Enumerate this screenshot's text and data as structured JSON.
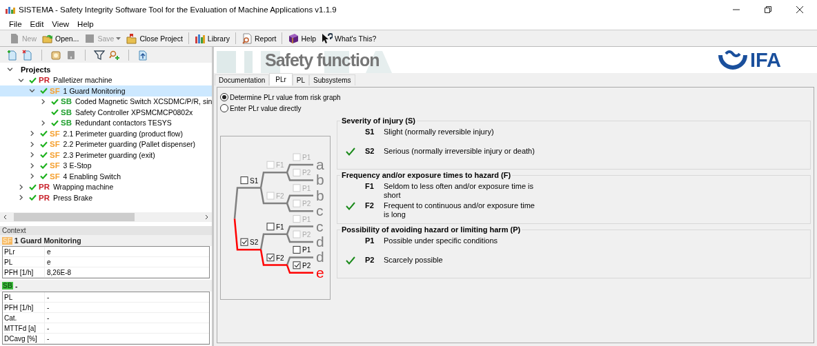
{
  "window": {
    "title": "SISTEMA - Safety Integrity Software Tool for the Evaluation of Machine Applications v1.1.9"
  },
  "menu": [
    "File",
    "Edit",
    "View",
    "Help"
  ],
  "toolbar": [
    [
      {
        "label": "New",
        "disabled": true,
        "dropdown": false
      },
      {
        "label": "Open...",
        "disabled": false,
        "dropdown": false
      },
      {
        "label": "Save",
        "disabled": true,
        "dropdown": true
      },
      {
        "label": "Close Project",
        "disabled": false,
        "dropdown": false
      }
    ],
    [
      {
        "label": "Library",
        "disabled": false,
        "dropdown": false
      }
    ],
    [
      {
        "label": "Report",
        "disabled": false,
        "dropdown": false
      }
    ],
    [
      {
        "label": "Help",
        "disabled": false,
        "dropdown": false
      },
      {
        "label": "What's This?",
        "disabled": false,
        "dropdown": false
      }
    ]
  ],
  "tree": {
    "root": {
      "label": "Projects",
      "expanded": true
    },
    "items": [
      {
        "kind": "PR",
        "label": "Palletizer machine",
        "valid": true,
        "expandable": true,
        "expanded": true,
        "selected": false,
        "children": [
          {
            "kind": "SF",
            "label": "1 Guard Monitoring",
            "valid": true,
            "expandable": true,
            "expanded": true,
            "selected": true,
            "children": [
              {
                "kind": "SB",
                "label": "Coded Magnetic Switch XCSDMC/P/R, sin",
                "valid": true,
                "expandable": true,
                "expanded": false,
                "selected": false
              },
              {
                "kind": "SB",
                "label": "Safety Controller XPSMCMCP0802x",
                "valid": true,
                "selected": false
              },
              {
                "kind": "SB",
                "label": "Redundant contactors TESYS",
                "valid": true,
                "expandable": true,
                "expanded": false,
                "selected": false
              }
            ]
          },
          {
            "kind": "SF",
            "label": "2.1 Perimeter guarding (product flow)",
            "valid": true,
            "expandable": true,
            "expanded": false,
            "selected": false
          },
          {
            "kind": "SF",
            "label": "2.2 Perimeter guarding (Pallet dispenser)",
            "valid": true,
            "expandable": true,
            "expanded": false,
            "selected": false
          },
          {
            "kind": "SF",
            "label": "2.3 Perimeter guarding (exit)",
            "valid": true,
            "expandable": true,
            "expanded": false,
            "selected": false
          },
          {
            "kind": "SF",
            "label": "3 E-Stop",
            "valid": true,
            "expandable": true,
            "expanded": false,
            "selected": false
          },
          {
            "kind": "SF",
            "label": "4 Enabling Switch",
            "valid": true,
            "expandable": true,
            "expanded": false,
            "selected": false
          }
        ]
      },
      {
        "kind": "PR",
        "label": "Wrapping machine",
        "valid": true,
        "expandable": true,
        "expanded": false,
        "selected": false
      },
      {
        "kind": "PR",
        "label": "Press Brake",
        "valid": true,
        "expandable": true,
        "expanded": false,
        "selected": false
      }
    ]
  },
  "context": {
    "title": "Context",
    "sections": [
      {
        "kind": "SF",
        "title": "1 Guard Monitoring",
        "rows": [
          {
            "label": "PLr",
            "value": "e"
          },
          {
            "label": "PL",
            "value": "e"
          },
          {
            "label": "PFH [1/h]",
            "value": "8,26E-8"
          }
        ]
      },
      {
        "kind": "SB",
        "title": "-",
        "rows": [
          {
            "label": "PL",
            "value": "-"
          },
          {
            "label": "PFH [1/h]",
            "value": "-"
          },
          {
            "label": "Cat.",
            "value": "-"
          },
          {
            "label": "MTTFd [a]",
            "value": "-"
          },
          {
            "label": "DCavg [%]",
            "value": "-"
          }
        ]
      }
    ]
  },
  "banner": {
    "title": "Safety function",
    "logo": "IFA"
  },
  "tabs": [
    {
      "label": "Documentation",
      "selected": false
    },
    {
      "label": "PLr",
      "selected": true
    },
    {
      "label": "PL",
      "selected": false
    },
    {
      "label": "Subsystems",
      "selected": false
    }
  ],
  "mode": [
    {
      "label": "Determine PLr value from risk graph",
      "selected": true
    },
    {
      "label": "Enter PLr value directly",
      "selected": false
    }
  ],
  "risk_graph": [
    {
      "label": "S1",
      "checked": false,
      "enabled": true,
      "children": [
        {
          "label": "F1",
          "checked": false,
          "enabled": false,
          "children": [
            {
              "label": "P1",
              "checked": false,
              "enabled": false,
              "result": "a"
            },
            {
              "label": "P2",
              "checked": false,
              "enabled": false,
              "result": "b"
            }
          ]
        },
        {
          "label": "F2",
          "checked": false,
          "enabled": false,
          "children": [
            {
              "label": "P1",
              "checked": false,
              "enabled": false,
              "result": "b"
            },
            {
              "label": "P2",
              "checked": false,
              "enabled": false,
              "result": "c"
            }
          ]
        }
      ]
    },
    {
      "label": "S2",
      "checked": true,
      "enabled": true,
      "children": [
        {
          "label": "F1",
          "checked": false,
          "enabled": true,
          "children": [
            {
              "label": "P1",
              "checked": false,
              "enabled": false,
              "result": "c"
            },
            {
              "label": "P2",
              "checked": false,
              "enabled": false,
              "result": "d"
            }
          ]
        },
        {
          "label": "F2",
          "checked": true,
          "enabled": true,
          "children": [
            {
              "label": "P1",
              "checked": false,
              "enabled": true,
              "result": "d"
            },
            {
              "label": "P2",
              "checked": true,
              "enabled": true,
              "result": "e"
            }
          ]
        }
      ]
    }
  ],
  "groups": [
    {
      "title": "Severity of injury (S)",
      "options": [
        {
          "code": "S1",
          "text": "Slight (normally reversible injury)",
          "selected": false
        },
        {
          "code": "S2",
          "text": "Serious (normally irreversible injury or death)",
          "selected": true
        }
      ]
    },
    {
      "title": "Frequency and/or exposure times to hazard (F)",
      "options": [
        {
          "code": "F1",
          "text": "Seldom to less often and/or exposure time is short",
          "selected": false
        },
        {
          "code": "F2",
          "text": "Frequent to continuous and/or exposure time is long",
          "selected": true
        }
      ]
    },
    {
      "title": "Possibility of avoiding hazard or limiting harm (P)",
      "options": [
        {
          "code": "P1",
          "text": "Possible under specific conditions",
          "selected": false
        },
        {
          "code": "P2",
          "text": "Scarcely possible",
          "selected": true
        }
      ]
    }
  ]
}
